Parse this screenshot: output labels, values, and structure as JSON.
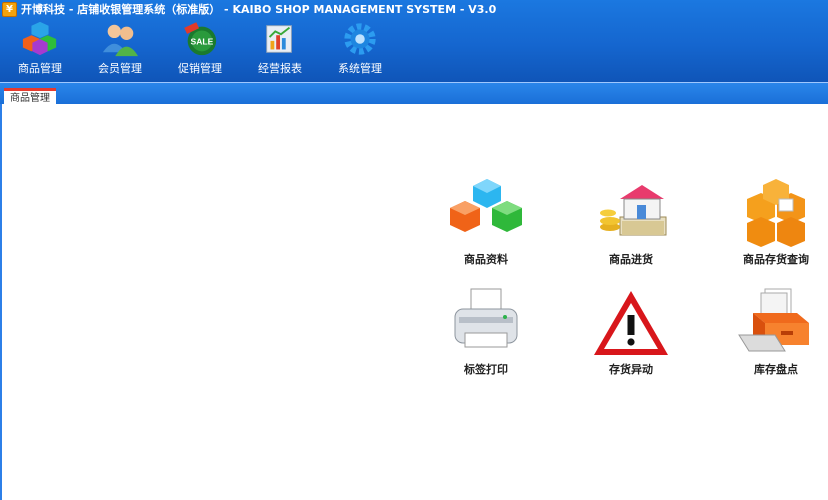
{
  "window": {
    "title": "开博科技 - 店铺收银管理系统（标准版） - KAIBO SHOP MANAGEMENT SYSTEM - V3.0",
    "app_icon": "¥"
  },
  "toolbar": [
    {
      "label": "商品管理",
      "icon": "cubes-icon"
    },
    {
      "label": "会员管理",
      "icon": "users-icon"
    },
    {
      "label": "促销管理",
      "icon": "sale-icon"
    },
    {
      "label": "经营报表",
      "icon": "report-icon"
    },
    {
      "label": "系统管理",
      "icon": "gear-icon"
    }
  ],
  "tabs": [
    {
      "label": "商品管理"
    }
  ],
  "tiles": [
    {
      "label": "商品资料",
      "icon": "cubes-icon"
    },
    {
      "label": "商品进货",
      "icon": "house-money-icon"
    },
    {
      "label": "商品存货查询",
      "icon": "boxes-icon"
    },
    {
      "label": "标签打印",
      "icon": "printer-icon"
    },
    {
      "label": "存货异动",
      "icon": "warning-icon"
    },
    {
      "label": "库存盘点",
      "icon": "drawer-icon"
    }
  ],
  "colors": {
    "header": "#1566cf",
    "tab_accent": "#e63b2e",
    "warning_red": "#d8161b"
  }
}
